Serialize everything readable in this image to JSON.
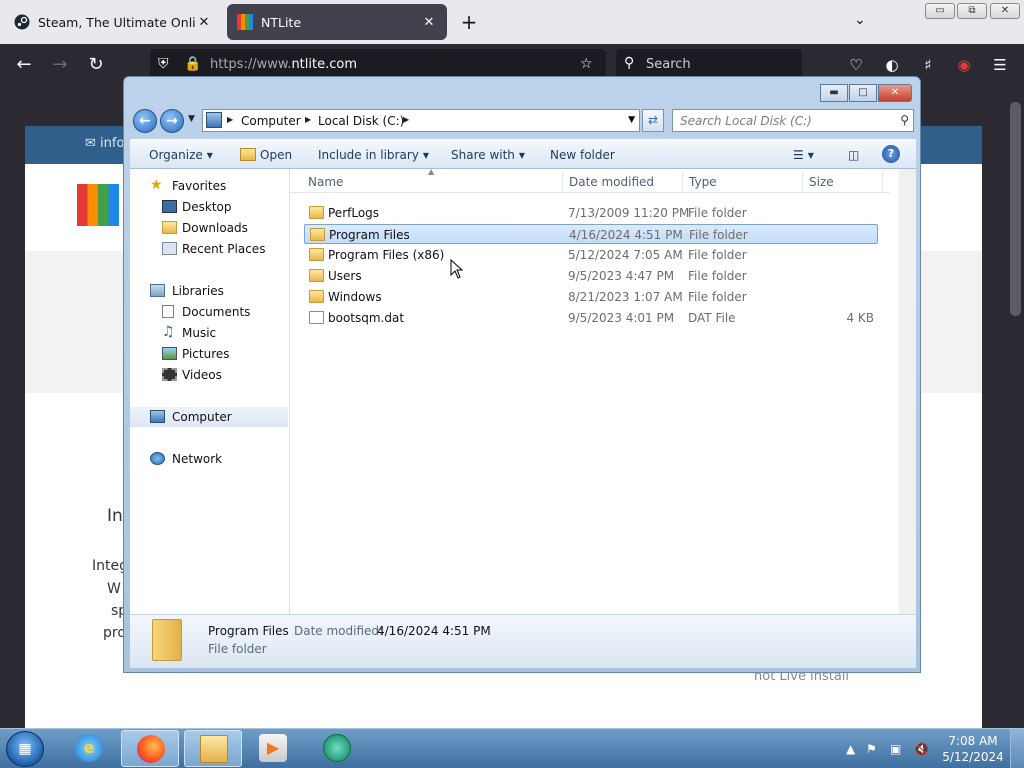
{
  "browser": {
    "tabs": [
      {
        "title": "Steam, The Ultimate Online Game Platform",
        "close": "✕"
      },
      {
        "title": "NTLite",
        "close": "✕"
      }
    ],
    "new_tab": "+",
    "url_host": "https://www.",
    "url_domain": "ntlite.com",
    "search_placeholder": "Search",
    "window_controls": [
      "▭",
      "⧉",
      "✕"
    ]
  },
  "webpage": {
    "top_mail": "info",
    "heading_fragment": "In",
    "body_fragments": [
      "Integ",
      "W",
      "sp",
      "pro"
    ],
    "footer_fragment": "not Live install"
  },
  "explorer": {
    "breadcrumb": [
      "Computer",
      "Local Disk (C:)"
    ],
    "search_placeholder": "Search Local Disk (C:)",
    "commands": {
      "organize": "Organize",
      "open": "Open",
      "include": "Include in library",
      "share": "Share with",
      "newfolder": "New folder"
    },
    "nav": {
      "favorites": "Favorites",
      "desktop": "Desktop",
      "downloads": "Downloads",
      "recent": "Recent Places",
      "libraries": "Libraries",
      "documents": "Documents",
      "music": "Music",
      "pictures": "Pictures",
      "videos": "Videos",
      "computer": "Computer",
      "network": "Network"
    },
    "columns": {
      "name": "Name",
      "date": "Date modified",
      "type": "Type",
      "size": "Size"
    },
    "files": [
      {
        "name": "PerfLogs",
        "date": "7/13/2009 11:20 PM",
        "type": "File folder",
        "size": ""
      },
      {
        "name": "Program Files",
        "date": "4/16/2024 4:51 PM",
        "type": "File folder",
        "size": ""
      },
      {
        "name": "Program Files (x86)",
        "date": "5/12/2024 7:05 AM",
        "type": "File folder",
        "size": ""
      },
      {
        "name": "Users",
        "date": "9/5/2023 4:47 PM",
        "type": "File folder",
        "size": ""
      },
      {
        "name": "Windows",
        "date": "8/21/2023 1:07 AM",
        "type": "File folder",
        "size": ""
      },
      {
        "name": "bootsqm.dat",
        "date": "9/5/2023 4:01 PM",
        "type": "DAT File",
        "size": "4 KB"
      }
    ],
    "details": {
      "name": "Program Files",
      "date_label": "Date modified:",
      "date": "4/16/2024 4:51 PM",
      "type": "File folder"
    }
  },
  "taskbar": {
    "time": "7:08 AM",
    "date": "5/12/2024"
  }
}
